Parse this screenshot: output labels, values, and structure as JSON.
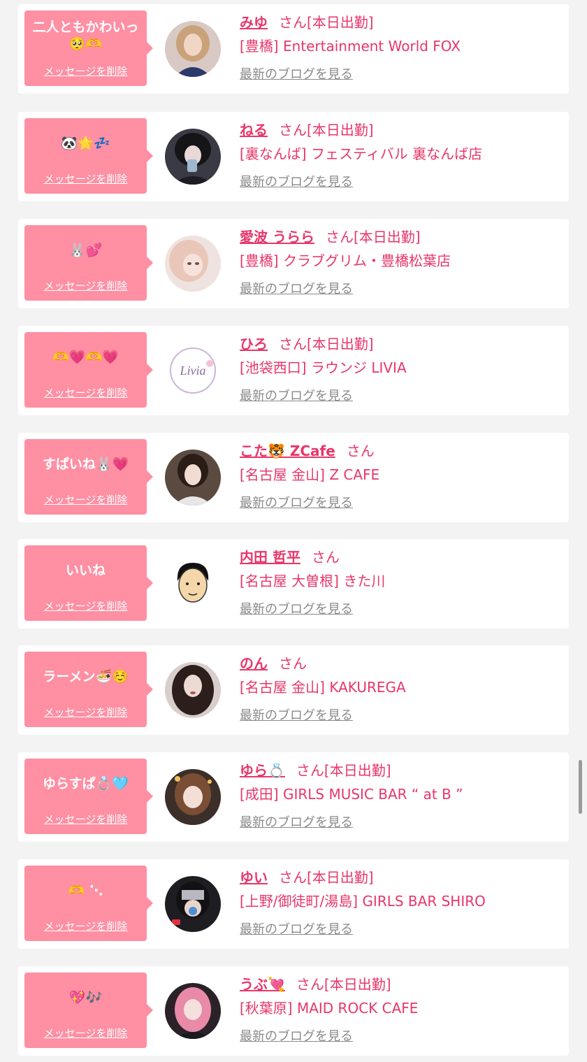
{
  "items": [
    {
      "message": "二人ともかわいっ🥺🫶",
      "delete_label": "メッセージを削除",
      "name": "みゆ",
      "honorific": "さん",
      "status": "[本日出勤]",
      "shop": "[豊橋] Entertainment World FOX",
      "blog_link": "最新のブログを見る",
      "avatar": "photo-woman-blonde"
    },
    {
      "message": "🐼🌟💤",
      "delete_label": "メッセージを削除",
      "name": "ねる",
      "honorific": "さん",
      "status": "[本日出勤]",
      "shop": "[裏なんば] フェスティバル 裏なんば店",
      "blog_link": "最新のブログを見る",
      "avatar": "photo-woman-dark"
    },
    {
      "message": "🐰💕",
      "delete_label": "メッセージを削除",
      "name": "愛波 うらら",
      "honorific": "さん",
      "status": "[本日出勤]",
      "shop": "[豊橋] クラブグリム・豊橋松葉店",
      "blog_link": "最新のブログを見る",
      "avatar": "photo-woman-pink"
    },
    {
      "message": "🫶💗🫶💗",
      "delete_label": "メッセージを削除",
      "name": "ひろ",
      "honorific": "さん",
      "status": "[本日出勤]",
      "shop": "[池袋西口] ラウンジ LIVIA",
      "blog_link": "最新のブログを見る",
      "avatar": "logo-livia",
      "avatar_text": "Livia"
    },
    {
      "message": "すぱいね🐰💗",
      "delete_label": "メッセージを削除",
      "name": "こた🐯 ZCafe",
      "honorific": "さん",
      "status": "",
      "shop": "[名古屋 金山] Z CAFE",
      "blog_link": "最新のブログを見る",
      "avatar": "photo-woman-hand"
    },
    {
      "message": "いいね",
      "delete_label": "メッセージを削除",
      "name": "内田 哲平",
      "honorific": "さん",
      "status": "",
      "shop": "[名古屋 大曽根] きた川",
      "blog_link": "最新のブログを見る",
      "avatar": "illustration-man"
    },
    {
      "message": "ラーメン🍜☺️",
      "delete_label": "メッセージを削除",
      "name": "のん",
      "honorific": "さん",
      "status": "",
      "shop": "[名古屋 金山] KAKUREGA",
      "blog_link": "最新のブログを見る",
      "avatar": "photo-woman-longhair"
    },
    {
      "message": "ゆらすぱ💍🩵",
      "delete_label": "メッセージを削除",
      "name": "ゆら💍",
      "honorific": "さん",
      "status": "[本日出勤]",
      "shop": "[成田] GIRLS MUSIC BAR “ at B ”",
      "blog_link": "最新のブログを見る",
      "avatar": "photo-woman-brown"
    },
    {
      "message": "🫶 ⋱",
      "delete_label": "メッセージを削除",
      "name": "ゆい",
      "honorific": "さん",
      "status": "[本日出勤]",
      "shop": "[上野/御徒町/湯島] GIRLS BAR SHIRO",
      "blog_link": "最新のブログを見る",
      "avatar": "photo-woman-pacifier"
    },
    {
      "message": "💖🎶",
      "delete_label": "メッセージを削除",
      "name": "うぶ💘",
      "honorific": "さん",
      "status": "[本日出勤]",
      "shop": "[秋葉原] MAID ROCK CAFE",
      "blog_link": "最新のブログを見る",
      "avatar": "photo-woman-pinkhair"
    }
  ],
  "colors": {
    "page_bg": "#f3f3f3",
    "card_bg": "#ffffff",
    "bubble_bg": "#ff8fa3",
    "accent_text": "#e8366a",
    "link_gray": "#8a8a8a"
  }
}
